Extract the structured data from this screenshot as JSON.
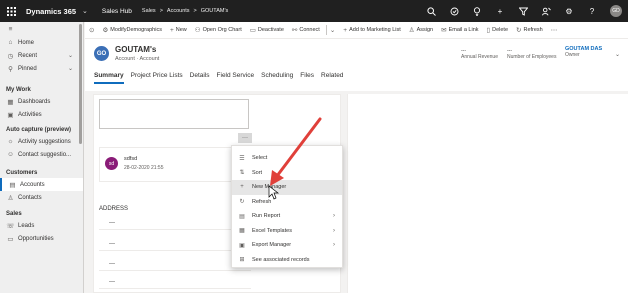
{
  "topbar": {
    "brand": "Dynamics 365",
    "app": "Sales Hub",
    "breadcrumbs": [
      "Sales",
      ">",
      "Accounts",
      ">",
      "GOUTAM's"
    ],
    "avatar_initials": "GD"
  },
  "sidebar": {
    "top_items": [
      {
        "icon": "home-icon",
        "label": "Home"
      },
      {
        "icon": "clock-icon",
        "label": "Recent"
      },
      {
        "icon": "pin-icon",
        "label": "Pinned"
      }
    ],
    "sections": [
      {
        "title": "My Work",
        "items": [
          {
            "icon": "dashboard-icon",
            "label": "Dashboards"
          },
          {
            "icon": "activities-icon",
            "label": "Activities"
          }
        ]
      },
      {
        "title": "Auto capture (preview)",
        "items": [
          {
            "icon": "bulb-icon",
            "label": "Activity suggestions"
          },
          {
            "icon": "contact-suggest-icon",
            "label": "Contact suggestio..."
          }
        ]
      },
      {
        "title": "Customers",
        "items": [
          {
            "icon": "accounts-icon",
            "label": "Accounts"
          },
          {
            "icon": "contacts-icon",
            "label": "Contacts"
          }
        ]
      },
      {
        "title": "Sales",
        "items": [
          {
            "icon": "leads-icon",
            "label": "Leads"
          },
          {
            "icon": "opportunities-icon",
            "label": "Opportunities"
          }
        ]
      }
    ]
  },
  "commandbar": {
    "modify": "ModifyDemographics",
    "new": "New",
    "org_chart": "Open Org Chart",
    "deactivate": "Deactivate",
    "connect": "Connect",
    "marketing": "Add to Marketing List",
    "assign": "Assign",
    "email_link": "Email a Link",
    "delete": "Delete",
    "refresh": "Refresh"
  },
  "header": {
    "avatar": "GO",
    "title": "GOUTAM's",
    "subtitle": "Account · Account",
    "annual_revenue_value": "---",
    "annual_revenue_label": "Annual Revenue",
    "employees_value": "---",
    "employees_label": "Number of Employees",
    "owner_value": "GOUTAM DAS",
    "owner_label": "Owner"
  },
  "tabs": [
    "Summary",
    "Project Price Lists",
    "Details",
    "Field Service",
    "Scheduling",
    "Files",
    "Related"
  ],
  "timeline": {
    "more": "···",
    "note_initials": "sd",
    "note_title": "sdfsd",
    "note_date": "28-02-2020 21:55"
  },
  "address": {
    "label": "ADDRESS",
    "fields": [
      "---",
      "---",
      "---",
      "---",
      "---"
    ]
  },
  "context_menu": [
    {
      "icon": "select-icon",
      "label": "Select",
      "submenu": false
    },
    {
      "icon": "sort-icon",
      "label": "Sort",
      "submenu": false
    },
    {
      "icon": "plus-icon",
      "label": "New Manager",
      "submenu": false
    },
    {
      "icon": "refresh-icon",
      "label": "Refresh",
      "submenu": false
    },
    {
      "icon": "report-icon",
      "label": "Run Report",
      "submenu": true
    },
    {
      "icon": "excel-icon",
      "label": "Excel Templates",
      "submenu": true
    },
    {
      "icon": "export-icon",
      "label": "Export Manager",
      "submenu": true
    },
    {
      "icon": "records-icon",
      "label": "See associated records",
      "submenu": false
    }
  ],
  "colors": {
    "accent": "#0f6cbd",
    "topbar": "#202020",
    "arrow": "#e0403a"
  }
}
